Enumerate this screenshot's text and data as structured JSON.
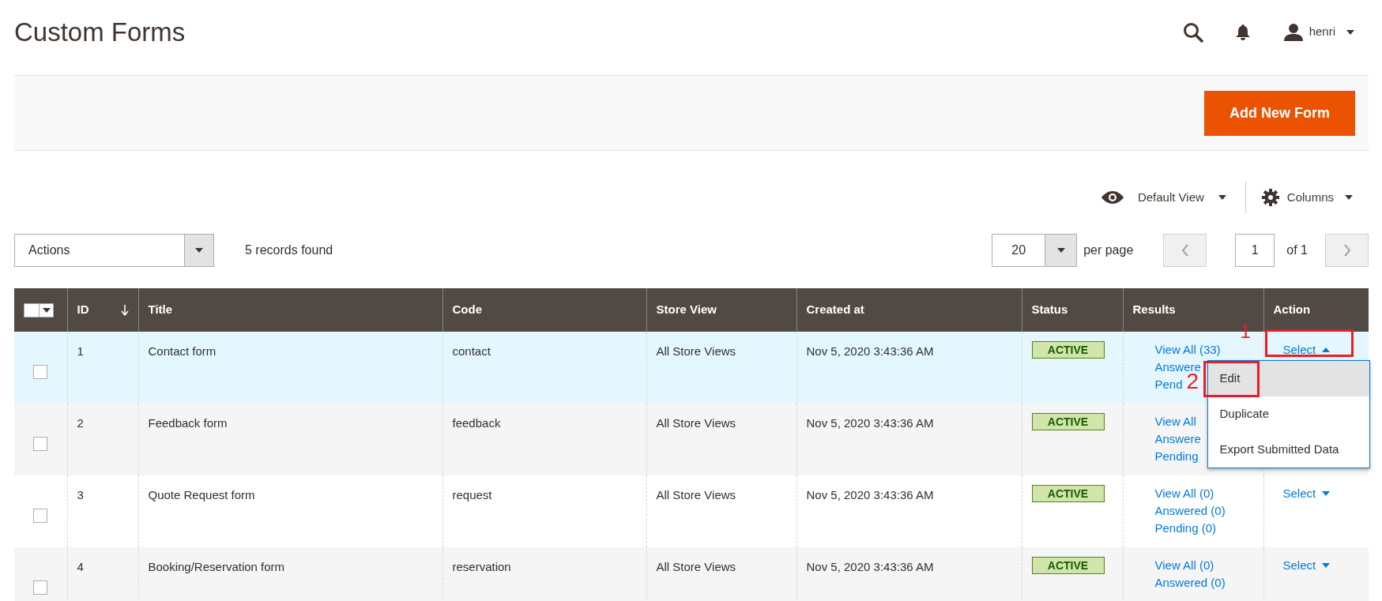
{
  "page_title": "Custom Forms",
  "header": {
    "user": "henri"
  },
  "primary_button": "Add New Form",
  "view_switcher": {
    "label": "Default View"
  },
  "columns_control": {
    "label": "Columns"
  },
  "mass_actions": {
    "label": "Actions"
  },
  "records_found": "5 records found",
  "pager": {
    "page_size": "20",
    "per_page_label": "per page",
    "page": "1",
    "total_pages_label": "of 1"
  },
  "table": {
    "columns": [
      {
        "label": "ID",
        "sorted": true
      },
      {
        "label": "Title",
        "sorted": false
      },
      {
        "label": "Code",
        "sorted": false
      },
      {
        "label": "Store View",
        "sorted": false
      },
      {
        "label": "Created at",
        "sorted": false
      },
      {
        "label": "Status",
        "sorted": false
      },
      {
        "label": "Results",
        "sorted": false
      },
      {
        "label": "Action",
        "sorted": false
      }
    ],
    "rows": [
      {
        "id": "1",
        "title": "Contact form",
        "code": "contact",
        "store_view": "All Store Views",
        "created_at": "Nov 5, 2020 3:43:36 AM",
        "status": "ACTIVE",
        "results": [
          "View All (33)",
          "Answere",
          "Pend"
        ],
        "action": "Select",
        "expanded": true,
        "checked": false,
        "highlighted": true
      },
      {
        "id": "2",
        "title": "Feedback form",
        "code": "feedback",
        "store_view": "All Store Views",
        "created_at": "Nov 5, 2020 3:43:36 AM",
        "status": "ACTIVE",
        "results": [
          "View All",
          "Answere",
          "Pending"
        ],
        "checked": false,
        "highlighted": false
      },
      {
        "id": "3",
        "title": "Quote Request form",
        "code": "request",
        "store_view": "All Store Views",
        "created_at": "Nov 5, 2020 3:43:36 AM",
        "status": "ACTIVE",
        "results": [
          "View All (0)",
          "Answered (0)",
          "Pending (0)"
        ],
        "action": "Select",
        "expanded": false,
        "checked": false,
        "highlighted": false
      },
      {
        "id": "4",
        "title": "Booking/Reservation form",
        "code": "reservation",
        "store_view": "All Store Views",
        "created_at": "Nov 5, 2020 3:43:36 AM",
        "status": "ACTIVE",
        "results": [
          "View All (0)",
          "Answered (0)"
        ],
        "action": "Select",
        "expanded": false,
        "checked": false,
        "highlighted": false
      }
    ]
  },
  "action_menu": {
    "items": [
      {
        "label": "Edit",
        "selected": true
      },
      {
        "label": "Duplicate",
        "selected": false
      },
      {
        "label": "Export Submitted Data",
        "selected": false
      }
    ]
  },
  "select_all": {
    "checked": false
  },
  "annotations": [
    {
      "label": "1",
      "kind": "select_frame"
    },
    {
      "label": "2",
      "kind": "item_frame"
    }
  ]
}
